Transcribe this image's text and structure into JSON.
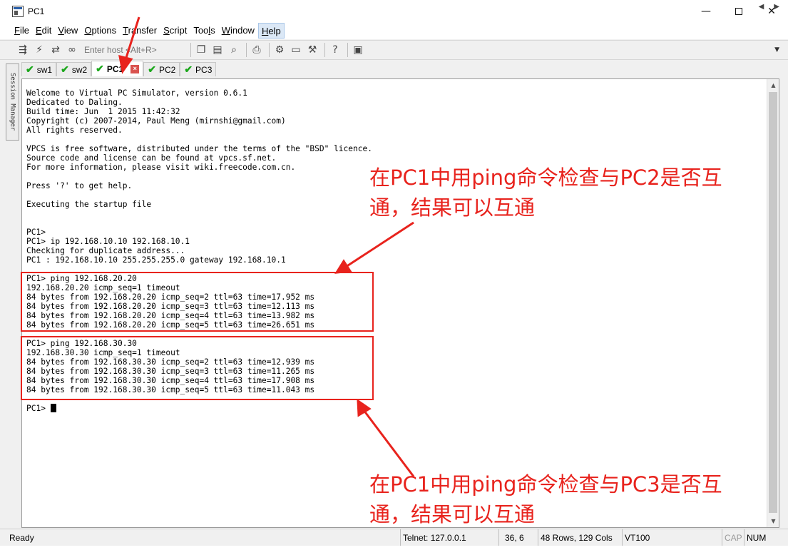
{
  "window": {
    "title": "PC1"
  },
  "menu": [
    {
      "pre": "",
      "ul": "F",
      "post": "ile"
    },
    {
      "pre": "",
      "ul": "E",
      "post": "dit"
    },
    {
      "pre": "",
      "ul": "V",
      "post": "iew"
    },
    {
      "pre": "",
      "ul": "O",
      "post": "ptions"
    },
    {
      "pre": "",
      "ul": "T",
      "post": "ransfer"
    },
    {
      "pre": "",
      "ul": "S",
      "post": "cript"
    },
    {
      "pre": "Too",
      "ul": "l",
      "post": "s"
    },
    {
      "pre": "",
      "ul": "W",
      "post": "indow"
    },
    {
      "pre": "",
      "ul": "H",
      "post": "elp"
    }
  ],
  "toolbar": {
    "host_placeholder": "Enter host <Alt+R>"
  },
  "session_manager": {
    "label": "Session Manager"
  },
  "tabs": [
    {
      "label": "sw1",
      "active": false
    },
    {
      "label": "sw2",
      "active": false
    },
    {
      "label": "PC1",
      "active": true
    },
    {
      "label": "PC2",
      "active": false
    },
    {
      "label": "PC3",
      "active": false
    }
  ],
  "terminal": {
    "lines": [
      "Welcome to Virtual PC Simulator, version 0.6.1",
      "Dedicated to Daling.",
      "Build time: Jun  1 2015 11:42:32",
      "Copyright (c) 2007-2014, Paul Meng (mirnshi@gmail.com)",
      "All rights reserved.",
      "",
      "VPCS is free software, distributed under the terms of the \"BSD\" licence.",
      "Source code and license can be found at vpcs.sf.net.",
      "For more information, please visit wiki.freecode.com.cn.",
      "",
      "Press '?' to get help.",
      "",
      "Executing the startup file",
      "",
      "",
      "PC1>",
      "PC1> ip 192.168.10.10 192.168.10.1",
      "Checking for duplicate address...",
      "PC1 : 192.168.10.10 255.255.255.0 gateway 192.168.10.1",
      "",
      "PC1> ping 192.168.20.20",
      "192.168.20.20 icmp_seq=1 timeout",
      "84 bytes from 192.168.20.20 icmp_seq=2 ttl=63 time=17.952 ms",
      "84 bytes from 192.168.20.20 icmp_seq=3 ttl=63 time=12.113 ms",
      "84 bytes from 192.168.20.20 icmp_seq=4 ttl=63 time=13.982 ms",
      "84 bytes from 192.168.20.20 icmp_seq=5 ttl=63 time=26.651 ms",
      "",
      "PC1> ping 192.168.30.30",
      "192.168.30.30 icmp_seq=1 timeout",
      "84 bytes from 192.168.30.30 icmp_seq=2 ttl=63 time=12.939 ms",
      "84 bytes from 192.168.30.30 icmp_seq=3 ttl=63 time=11.265 ms",
      "84 bytes from 192.168.30.30 icmp_seq=4 ttl=63 time=17.908 ms",
      "84 bytes from 192.168.30.30 icmp_seq=5 ttl=63 time=11.043 ms",
      "",
      "PC1> "
    ]
  },
  "annotations": {
    "top_line1": "在PC1中用ping命令检查与PC2是否互",
    "top_line2": "通，结果可以互通",
    "bottom_line1": "在PC1中用ping命令检查与PC3是否互",
    "bottom_line2": "通，结果可以互通",
    "color": "#e8231d"
  },
  "status": {
    "ready": "Ready",
    "connection": "Telnet: 127.0.0.1",
    "cursor_pos": "36,  6",
    "size": "48 Rows, 129 Cols",
    "terminal_type": "VT100",
    "cap": "CAP",
    "num": "NUM"
  }
}
